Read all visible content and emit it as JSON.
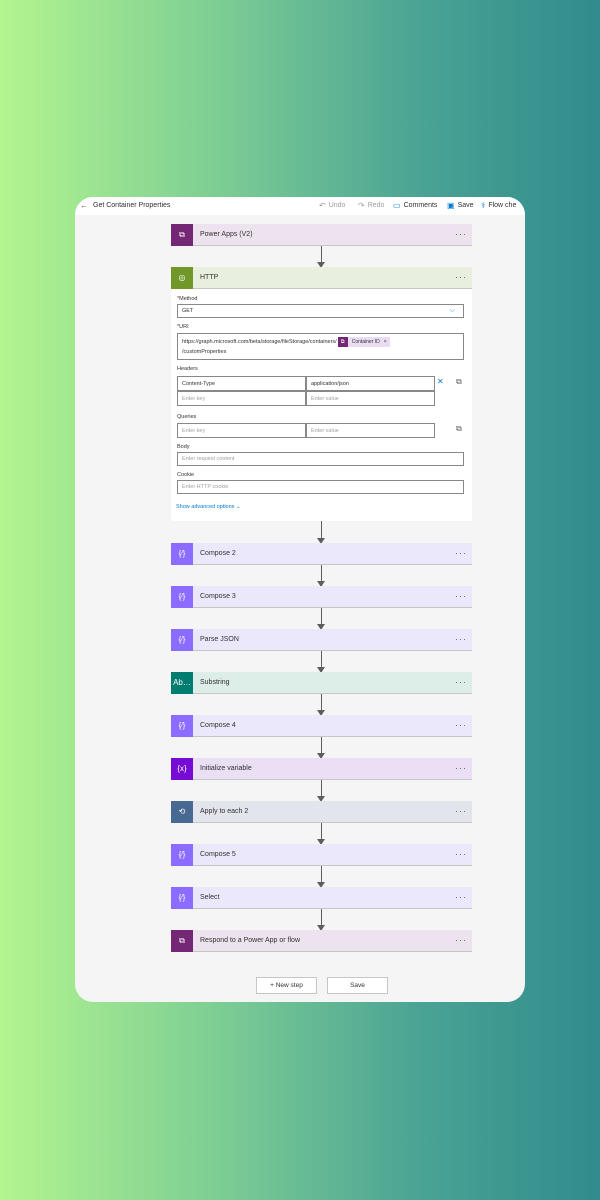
{
  "topbar": {
    "title": "Get Container Properties",
    "undo": "Undo",
    "redo": "Redo",
    "comments": "Comments",
    "save": "Save",
    "flow_checker": "Flow che"
  },
  "steps": [
    {
      "name": "Power Apps (V2)",
      "icon": "powerapps-icon",
      "color": "#742774",
      "bg": "#ede3ef"
    },
    {
      "name": "HTTP",
      "icon": "globe-icon",
      "color": "#709727",
      "bg": "#e8efdf"
    },
    {
      "name": "Compose 2",
      "icon": "compose-icon",
      "color": "#8c6cff",
      "bg": "#ece8fb"
    },
    {
      "name": "Compose 3",
      "icon": "compose-icon",
      "color": "#8c6cff",
      "bg": "#ece8fb"
    },
    {
      "name": "Parse JSON",
      "icon": "compose-icon",
      "color": "#8c6cff",
      "bg": "#ece8fb"
    },
    {
      "name": "Substring",
      "icon": "text-icon",
      "color": "#007c70",
      "bg": "#ddeee9"
    },
    {
      "name": "Compose 4",
      "icon": "compose-icon",
      "color": "#8c6cff",
      "bg": "#ece8fb"
    },
    {
      "name": "Initialize variable",
      "icon": "variable-icon",
      "color": "#770bd6",
      "bg": "#eadff5"
    },
    {
      "name": "Apply to each 2",
      "icon": "loop-icon",
      "color": "#486991",
      "bg": "#e2e6ec"
    },
    {
      "name": "Compose 5",
      "icon": "compose-icon",
      "color": "#8c6cff",
      "bg": "#ece8fb"
    },
    {
      "name": "Select",
      "icon": "compose-icon",
      "color": "#8c6cff",
      "bg": "#ece8fb"
    },
    {
      "name": "Respond to a Power App or flow",
      "icon": "powerapps-icon",
      "color": "#742774",
      "bg": "#ede3ef"
    }
  ],
  "http": {
    "method_label": "Method",
    "method_value": "GET",
    "uri_label": "URI",
    "uri_prefix": "https://graph.microsoft.com/beta/storage/fileStorage/containers/",
    "uri_token": "Container ID",
    "uri_suffix": "/customProperties",
    "headers_label": "Headers",
    "header_key": "Content-Type",
    "header_value": "application/json",
    "key_placeholder": "Enter key",
    "value_placeholder": "Enter value",
    "queries_label": "Queries",
    "body_label": "Body",
    "body_placeholder": "Enter request content",
    "cookie_label": "Cookie",
    "cookie_placeholder": "Enter HTTP cookie",
    "advanced_link": "Show advanced options"
  },
  "footer": {
    "new_step": "+ New step",
    "save": "Save"
  }
}
